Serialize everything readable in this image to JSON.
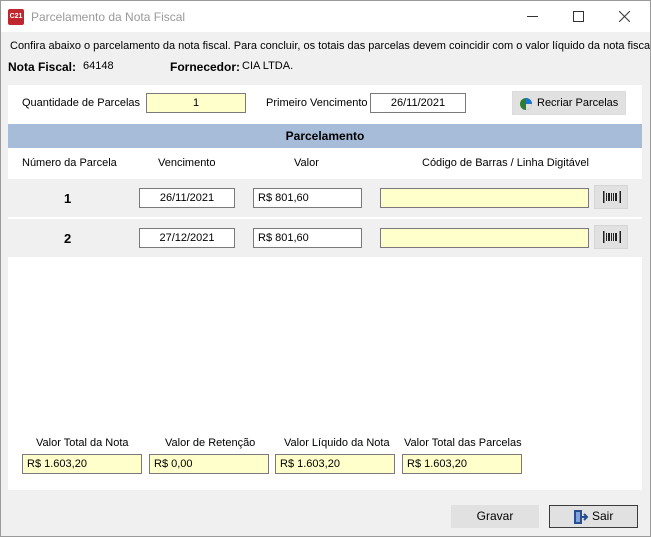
{
  "window": {
    "app_icon_text": "C21",
    "title": "Parcelamento da Nota Fiscal"
  },
  "intro_text": "Confira abaixo o parcelamento da nota fiscal. Para concluir, os totais das parcelas devem coincidir com o valor líquido da nota fiscal.",
  "nota": {
    "label": "Nota Fiscal:",
    "value": "64148"
  },
  "fornecedor": {
    "label": "Fornecedor:",
    "value": "CIA LTDA."
  },
  "params": {
    "quantidade_label": "Quantidade de Parcelas",
    "quantidade_value": "1",
    "vencimento_label": "Primeiro Vencimento",
    "vencimento_value": "26/11/2021",
    "recriar_label": "Recriar Parcelas"
  },
  "section_title": "Parcelamento",
  "columns": {
    "numero": "Número da Parcela",
    "vencimento": "Vencimento",
    "valor": "Valor",
    "codigo": "Código de Barras / Linha Digitável"
  },
  "parcelas": [
    {
      "numero": "1",
      "vencimento": "26/11/2021",
      "valor": "R$ 801,60",
      "codigo": ""
    },
    {
      "numero": "2",
      "vencimento": "27/12/2021",
      "valor": "R$ 801,60",
      "codigo": ""
    }
  ],
  "totals": {
    "liquido_nota_label": "Valor Total da Nota",
    "liquido_nota_value": "R$ 1.603,20",
    "retencao_label": "Valor de Retenção",
    "retencao_value": "R$ 0,00",
    "liquido_label": "Valor Líquido da Nota",
    "liquido_value": "R$ 1.603,20",
    "parcelas_label": "Valor Total das Parcelas",
    "parcelas_value": "R$ 1.603,20"
  },
  "buttons": {
    "gravar": "Gravar",
    "sair": "Sair"
  },
  "colors": {
    "header_band": "#a6bcd8",
    "input_yellow": "#ffffcc",
    "app_icon": "#c0262d"
  }
}
